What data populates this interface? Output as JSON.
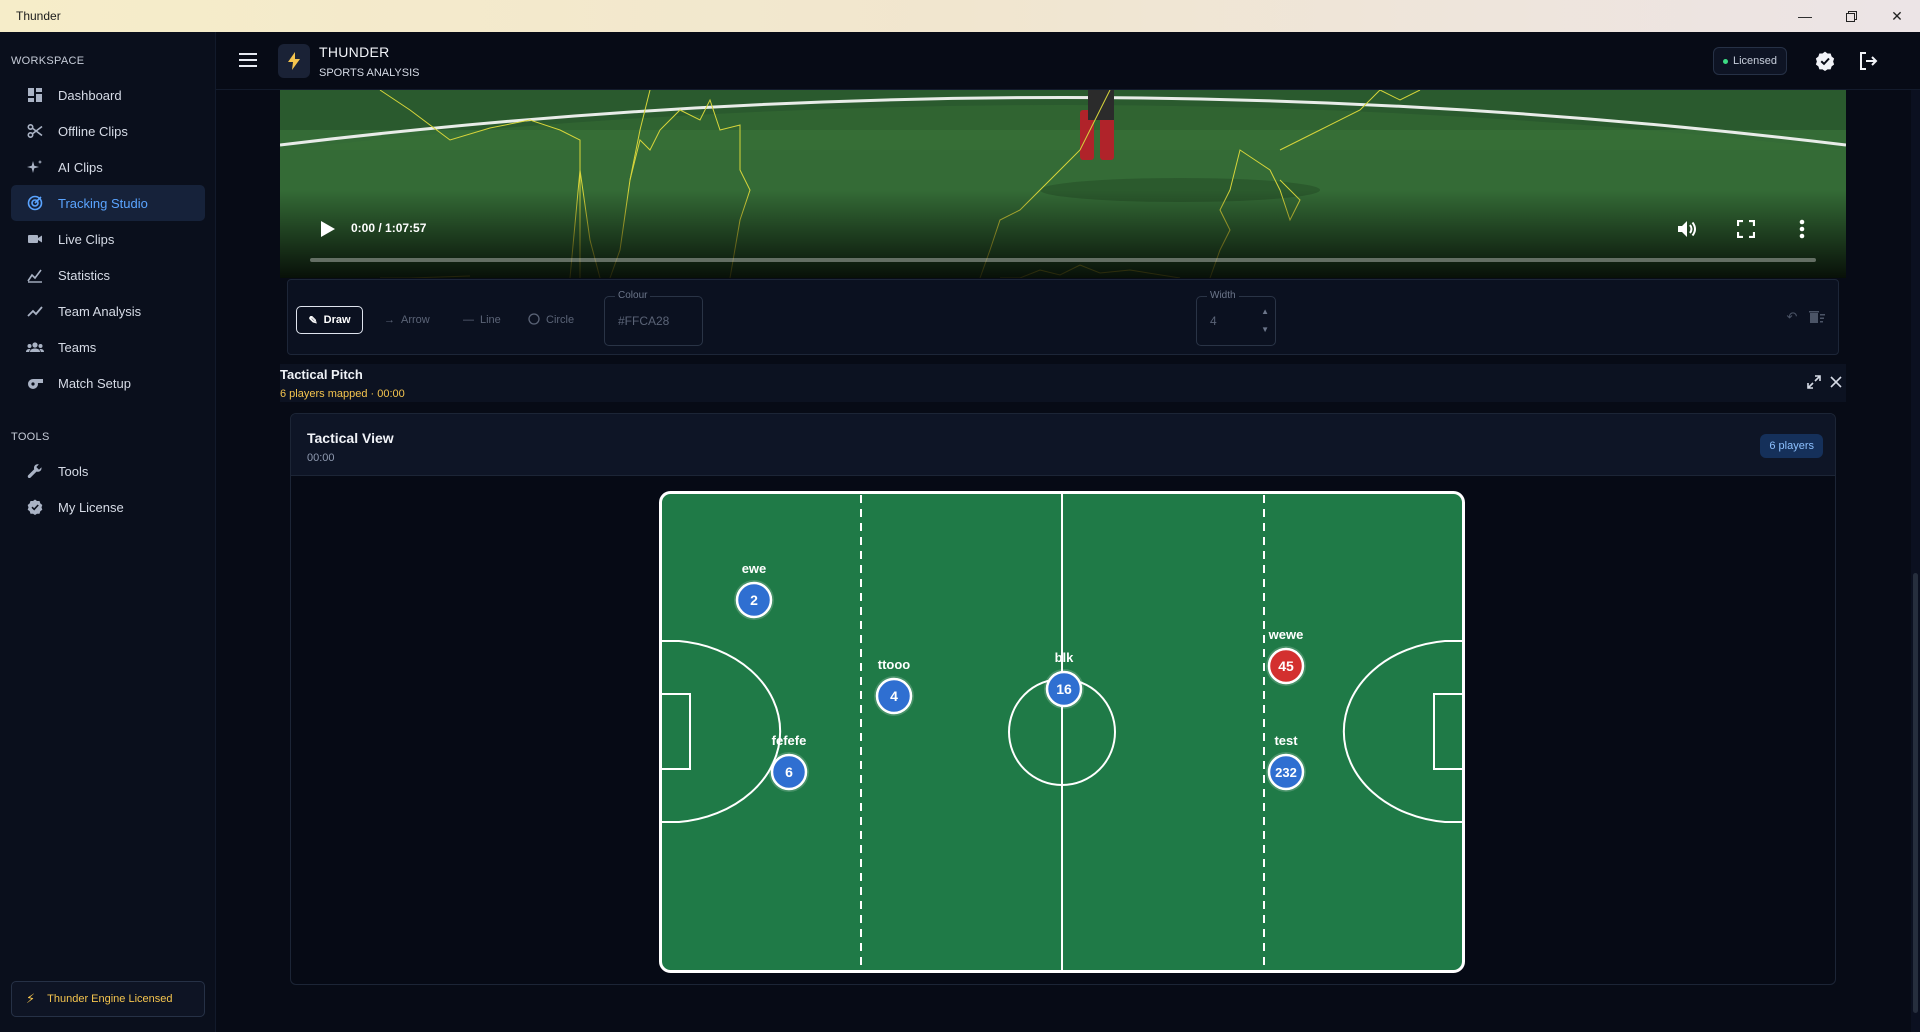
{
  "window": {
    "title": "Thunder"
  },
  "sidebar": {
    "workspace_label": "WORKSPACE",
    "items": [
      {
        "label": "Dashboard",
        "icon": "dashboard-icon"
      },
      {
        "label": "Offline Clips",
        "icon": "scissors-icon"
      },
      {
        "label": "AI Clips",
        "icon": "sparkle-icon"
      },
      {
        "label": "Tracking Studio",
        "icon": "tracking-icon",
        "active": true
      },
      {
        "label": "Live Clips",
        "icon": "video-camera-icon"
      },
      {
        "label": "Statistics",
        "icon": "statistics-icon"
      },
      {
        "label": "Team Analysis",
        "icon": "trend-icon"
      },
      {
        "label": "Teams",
        "icon": "teams-icon"
      },
      {
        "label": "Match Setup",
        "icon": "whistle-icon"
      }
    ],
    "tools_label": "TOOLS",
    "tools_items": [
      {
        "label": "Tools",
        "icon": "wrench-icon"
      },
      {
        "label": "My License",
        "icon": "verified-badge-icon"
      }
    ],
    "license_badge": "Thunder Engine Licensed"
  },
  "header": {
    "app_title": "THUNDER",
    "app_subtitle": "SPORTS ANALYSIS",
    "licensed_label": "Licensed"
  },
  "video": {
    "time": "0:00 / 1:07:57",
    "progress": 0
  },
  "toolbar": {
    "draw_label": "Draw",
    "arrow_label": "Arrow",
    "line_label": "Line",
    "circle_label": "Circle",
    "colour_label": "Colour",
    "colour_value": "#FFCA28",
    "width_label": "Width",
    "width_value": "4"
  },
  "tactical_pitch": {
    "title": "Tactical Pitch",
    "subtitle": "6 players mapped · 00:00"
  },
  "tactical_view": {
    "title": "Tactical View",
    "time": "00:00",
    "player_count": "6 players",
    "players": [
      {
        "name": "ewe",
        "number": "2",
        "team": "blue"
      },
      {
        "name": "ttooo",
        "number": "4",
        "team": "blue"
      },
      {
        "name": "fefefe",
        "number": "6",
        "team": "blue"
      },
      {
        "name": "blk",
        "number": "16",
        "team": "blue"
      },
      {
        "name": "wewe",
        "number": "45",
        "team": "red"
      },
      {
        "name": "test",
        "number": "232",
        "team": "blue"
      }
    ]
  },
  "colors": {
    "accent": "#5aa4ff",
    "brand_yellow": "#f4c44e",
    "pitch_green": "#1f7a47",
    "team_blue": "#2f6fd1",
    "team_red": "#d3302f",
    "drawing_colour": "#FFCA28"
  }
}
